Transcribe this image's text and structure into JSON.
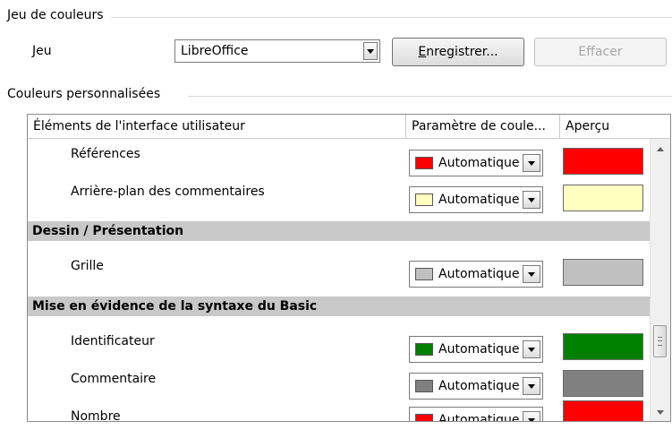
{
  "scheme_section": {
    "title": "Jeu de couleurs",
    "scheme_label": "Jeu",
    "scheme_value": "LibreOffice",
    "save_button": "Enregistrer...",
    "delete_button": "Effacer"
  },
  "custom_section": {
    "title": "Couleurs personnalisées"
  },
  "table": {
    "headers": {
      "element": "Éléments de l'interface utilisateur",
      "setting": "Paramètre de coule...",
      "preview": "Aperçu"
    },
    "rows": [
      {
        "label": "Références",
        "setting": "Automatique",
        "color": "#ff0000"
      },
      {
        "label": "Arrière-plan des commentaires",
        "setting": "Automatique",
        "color": "#ffffc0"
      },
      {
        "group": "Dessin / Présentation"
      },
      {
        "label": "Grille",
        "setting": "Automatique",
        "color": "#c0c0c0"
      },
      {
        "group": "Mise en évidence de la syntaxe du Basic"
      },
      {
        "label": "Identificateur",
        "setting": "Automatique",
        "color": "#008000"
      },
      {
        "label": "Commentaire",
        "setting": "Automatique",
        "color": "#808080"
      },
      {
        "label": "Nombre",
        "setting": "Automatique",
        "color": "#ff0000"
      }
    ]
  }
}
